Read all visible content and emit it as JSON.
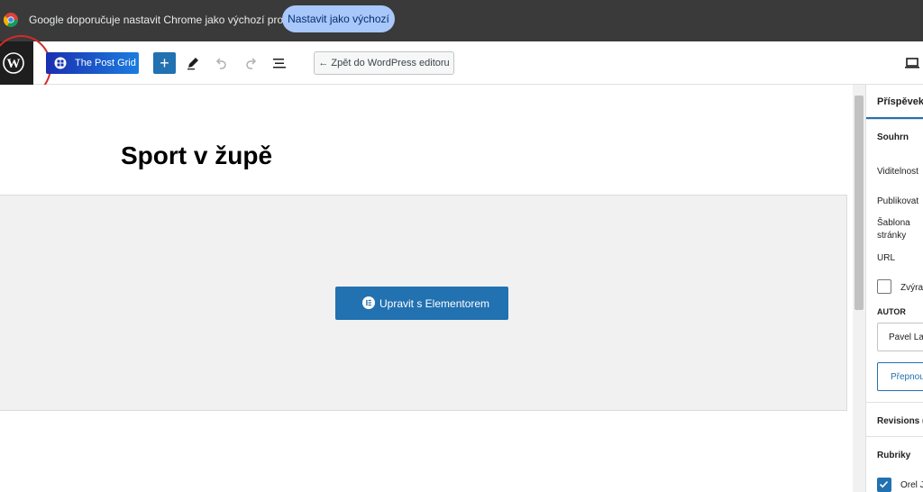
{
  "infobar": {
    "message": "Google doporučuje nastavit Chrome jako výchozí prohlížeč",
    "button_label": "Nastavit jako výchozí"
  },
  "toolbar": {
    "post_grid_label": "The Post Grid",
    "add_block": "+",
    "back_label": "← Zpět do WordPress editoru"
  },
  "canvas": {
    "post_title": "Sport v župě",
    "elementor_button_label": "Upravit s Elementorem"
  },
  "sidebar": {
    "tab_post": "Příspěvek",
    "summary": "Souhrn",
    "visibility": "Viditelnost",
    "publish": "Publikovat",
    "template_line1": "Šablona",
    "template_line2": "stránky",
    "url": "URL",
    "sticky_label": "Zvýraz",
    "author_heading": "AUTOR",
    "author_value": "Pavel Lav",
    "switch_label": "Přepnou",
    "revisions": "Revisions (",
    "categories": "Rubriky",
    "category_item": "Orel J"
  },
  "colors": {
    "accent": "#2271b1",
    "infobar_bg": "#3a3a3a",
    "infobar_button": "#a8c7fa",
    "annotation_circle": "#d42a2a"
  }
}
